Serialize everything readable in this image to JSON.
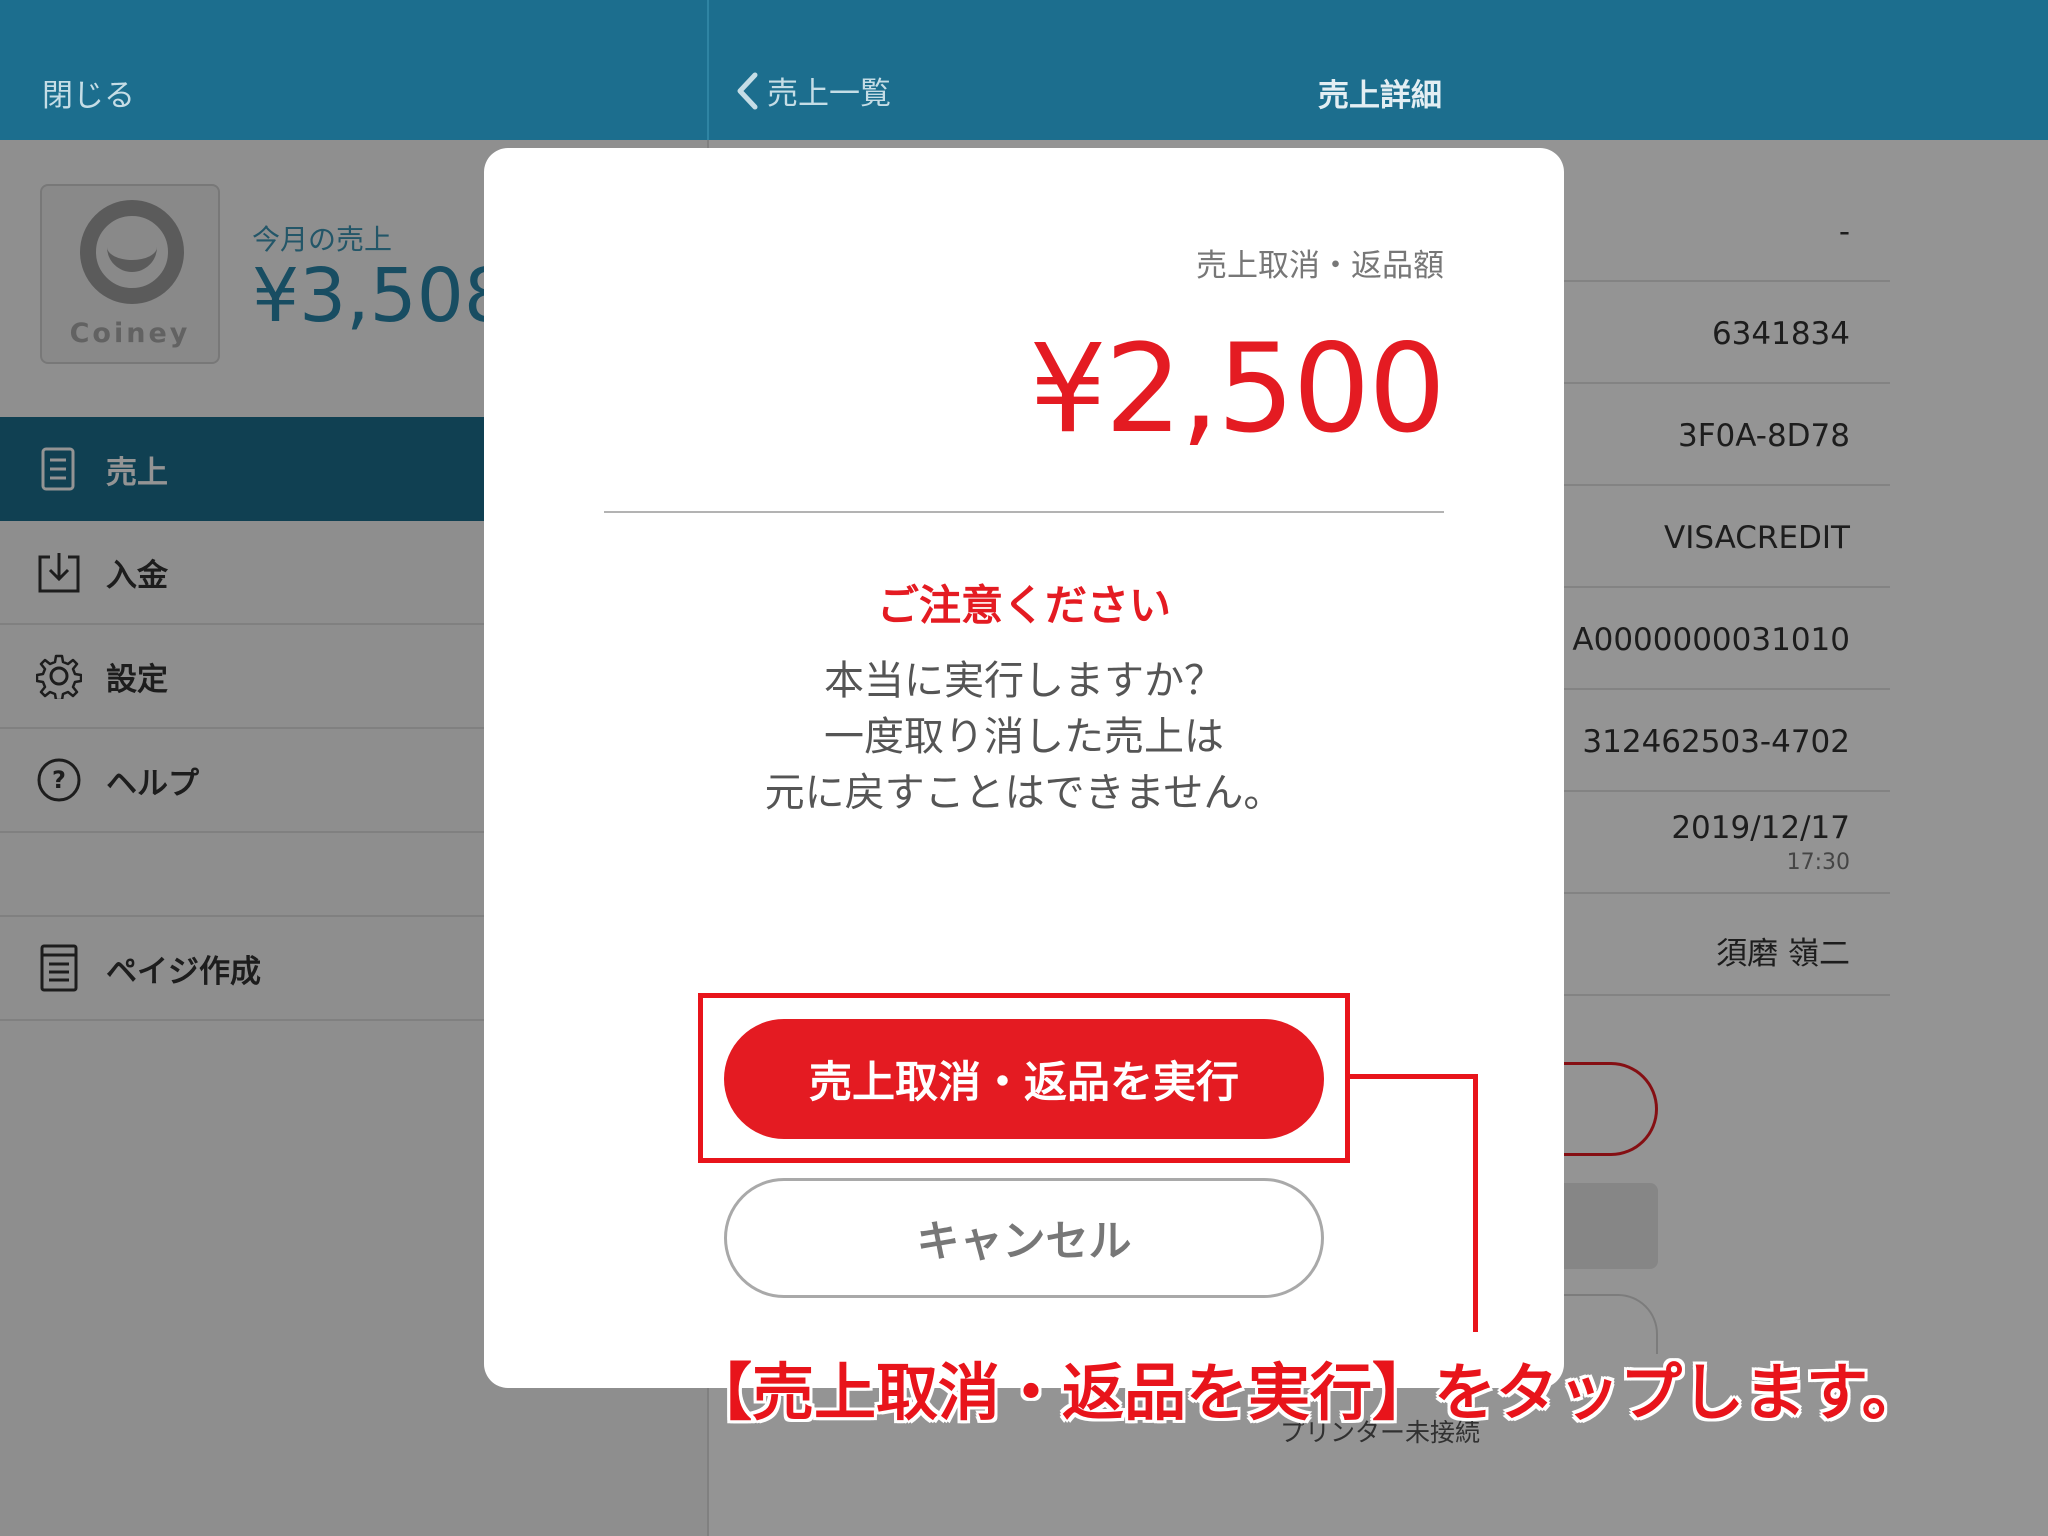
{
  "header": {
    "close_label": "閉じる",
    "back_label": "売上一覧",
    "title": "売上詳細"
  },
  "profile": {
    "logo_text": "Coiney",
    "sales_label": "今月の売上",
    "sales_amount": "¥3,508"
  },
  "sidebar": {
    "items": [
      {
        "label": "売上",
        "icon": "document-icon",
        "active": true
      },
      {
        "label": "入金",
        "icon": "download-tray-icon",
        "active": false
      },
      {
        "label": "設定",
        "icon": "gear-icon",
        "active": false
      },
      {
        "label": "ヘルプ",
        "icon": "question-circle-icon",
        "active": false
      },
      {
        "label": "ペイジ作成",
        "icon": "page-icon",
        "active": false
      }
    ]
  },
  "detail": {
    "rows": [
      {
        "value": "-"
      },
      {
        "value": "6341834"
      },
      {
        "value": "3F0A-8D78"
      },
      {
        "value": "VISACREDIT"
      },
      {
        "value": "A0000000031010"
      },
      {
        "value": "312462503-4702"
      },
      {
        "value": "2019/12/17",
        "sub": "17:30"
      },
      {
        "value": "須磨 嶺二"
      }
    ],
    "printer_status": "プリンター未接続"
  },
  "modal": {
    "label": "売上取消・返品額",
    "amount": "¥2,500",
    "warning_title": "ご注意ください",
    "body_lines": [
      "本当に実行しますか？",
      "一度取り消した売上は",
      "元に戻すことはできません。"
    ],
    "confirm_label": "売上取消・返品を実行",
    "cancel_label": "キャンセル"
  },
  "annotation": {
    "text": "【売上取消・返品を実行】をタップします。"
  },
  "colors": {
    "header_bg": "#1c6e8e",
    "accent_red": "#e41b22",
    "annotation_red": "#e8141b"
  }
}
